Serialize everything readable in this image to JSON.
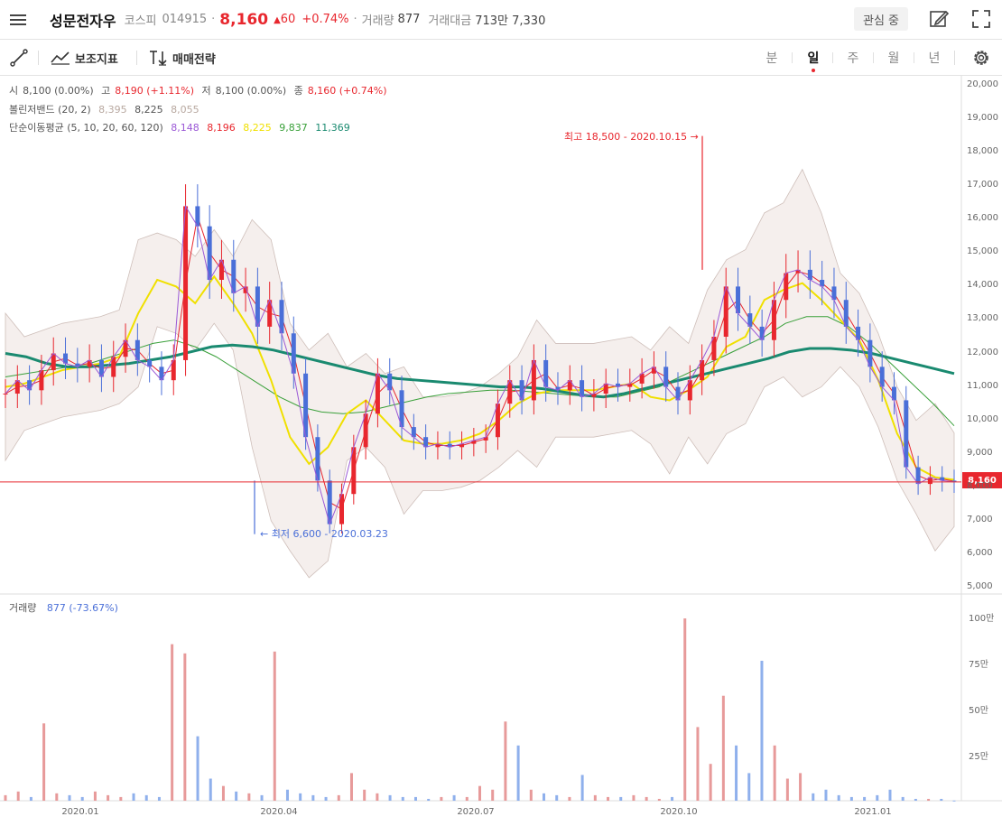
{
  "header": {
    "menu_icon": "hamburger-menu-icon",
    "stock_name": "성문전자우",
    "market": "코스피",
    "code": "014915",
    "price": "8,160",
    "change_arrow": "▲",
    "change": "60",
    "change_pct": "+0.74%",
    "volume_label": "거래량",
    "volume_value": "877",
    "trade_amount_label": "거래대금",
    "trade_amount_value": "713만 7,330",
    "favorite_label": "관심 중",
    "edit_icon": "edit-icon",
    "fullscreen_icon": "fullscreen-icon"
  },
  "toolbar": {
    "draw_icon": "line-draw-icon",
    "indicator_label": "보조지표",
    "strategy_label": "매매전략",
    "periods": [
      "분",
      "일",
      "주",
      "월",
      "년"
    ],
    "active_period": "일",
    "settings_icon": "gear-icon"
  },
  "legend": {
    "ohlc": [
      {
        "label": "시",
        "value": "8,100 (0.00%)",
        "color": "#555555"
      },
      {
        "label": "고",
        "value": "8,190 (+1.11%)",
        "color": "#e8272e"
      },
      {
        "label": "저",
        "value": "8,100 (0.00%)",
        "color": "#555555"
      },
      {
        "label": "종",
        "value": "8,160 (+0.74%)",
        "color": "#e8272e"
      }
    ],
    "bollinger_label": "볼린저밴드 (20, 2)",
    "bollinger_values": [
      {
        "value": "8,395",
        "color": "#b8a8a0"
      },
      {
        "value": "8,225",
        "color": "#555555"
      },
      {
        "value": "8,055",
        "color": "#b8a8a0"
      }
    ],
    "ma_label": "단순이동평균 (5, 10, 20, 60, 120)",
    "ma_values": [
      {
        "value": "8,148",
        "color": "#9b59d6"
      },
      {
        "value": "8,196",
        "color": "#e8272e"
      },
      {
        "value": "8,225",
        "color": "#f0e000"
      },
      {
        "value": "9,837",
        "color": "#3aa03a"
      },
      {
        "value": "11,369",
        "color": "#1a8a70"
      }
    ]
  },
  "annotations": {
    "high": "최고 18,500 - 2020.10.15 →",
    "low": "← 최저 6,600 - 2020.03.23"
  },
  "current_price_label": "8,160",
  "volume_legend": {
    "label": "거래량",
    "value": "877 (-73.67%)"
  },
  "colors": {
    "up": "#e8272e",
    "down": "#4a6fd8",
    "ma5": "#9b59d6",
    "ma10": "#e8272e",
    "ma20": "#f0e000",
    "ma60": "#3aa03a",
    "ma120": "#1a8a70"
  },
  "chart_data": {
    "type": "candlestick",
    "price_axis_ticks": [
      "20,000",
      "19,000",
      "18,000",
      "17,000",
      "16,000",
      "15,000",
      "14,000",
      "13,000",
      "12,000",
      "11,000",
      "10,000",
      "9,000",
      "8,000",
      "7,000",
      "6,000",
      "5,000"
    ],
    "ylim": [
      5000,
      20000
    ],
    "volume_axis_ticks": [
      "100만",
      "75만",
      "50만",
      "25만"
    ],
    "volume_ylim": [
      0,
      1000000
    ],
    "x_ticks": [
      "2020.01",
      "2020.04",
      "2020.07",
      "2020.10",
      "2021.01"
    ],
    "high": {
      "value": 18500,
      "date": "2020.10.15"
    },
    "low": {
      "value": 6600,
      "date": "2020.03.23"
    },
    "last_close": 8160,
    "closes": [
      10800,
      11200,
      10900,
      11500,
      12000,
      11700,
      11600,
      11800,
      11300,
      11900,
      12400,
      11800,
      11600,
      11200,
      11800,
      16400,
      15800,
      14200,
      14800,
      13800,
      14000,
      12800,
      13600,
      12600,
      11400,
      9500,
      8200,
      6900,
      7800,
      9200,
      10200,
      11400,
      10900,
      9800,
      9500,
      9200,
      9300,
      9200,
      9300,
      9400,
      9500,
      10500,
      11200,
      10600,
      11800,
      11000,
      10900,
      11200,
      10700,
      10800,
      11100,
      11000,
      11100,
      11400,
      11600,
      11000,
      10600,
      11200,
      11800,
      12500,
      14000,
      13200,
      12800,
      12400,
      13600,
      14400,
      14500,
      14200,
      14000,
      13600,
      12800,
      12400,
      11600,
      11000,
      10600,
      8600,
      8100,
      8300,
      8200,
      8160
    ],
    "ma120": [
      12000,
      11900,
      11700,
      11600,
      11600,
      11650,
      11700,
      11800,
      11900,
      12050,
      12200,
      12250,
      12200,
      12100,
      11950,
      11800,
      11650,
      11500,
      11350,
      11250,
      11200,
      11150,
      11100,
      11050,
      11000,
      11000,
      10950,
      10850,
      10750,
      10700,
      10800,
      10950,
      11100,
      11250,
      11400,
      11550,
      11700,
      11850,
      12050,
      12150,
      12150,
      12100,
      12000,
      11850,
      11700,
      11550,
      11400
    ],
    "ma60": [
      11300,
      11400,
      11500,
      11600,
      11700,
      11900,
      12100,
      12300,
      12400,
      12200,
      11900,
      11500,
      11100,
      10700,
      10400,
      10250,
      10200,
      10250,
      10400,
      10550,
      10700,
      10800,
      10850,
      10900,
      10900,
      10850,
      10800,
      10750,
      10700,
      10700,
      10850,
      11000,
      11300,
      11600,
      11900,
      12200,
      12500,
      12900,
      13100,
      13100,
      12800,
      12300,
      11700,
      11100,
      10500,
      9837
    ],
    "ma20": [
      11000,
      11100,
      11300,
      11500,
      11600,
      11700,
      11900,
      13200,
      14200,
      14000,
      13500,
      14300,
      13500,
      12600,
      11200,
      9500,
      8700,
      9200,
      10200,
      10600,
      10000,
      9400,
      9300,
      9300,
      9400,
      9600,
      10000,
      10500,
      10800,
      10900,
      10900,
      10900,
      11000,
      11100,
      10700,
      10600,
      10900,
      11300,
      12200,
      12500,
      13600,
      13900,
      14100,
      13600,
      13000,
      12400,
      11200,
      9600,
      8600,
      8300,
      8225
    ],
    "volumes_wan": [
      3,
      5,
      2,
      42,
      4,
      3,
      2,
      5,
      3,
      2,
      4,
      3,
      2,
      85,
      80,
      35,
      12,
      8,
      5,
      4,
      3,
      81,
      6,
      4,
      3,
      2,
      3,
      15,
      6,
      4,
      3,
      2,
      2,
      1,
      2,
      3,
      2,
      8,
      6,
      43,
      30,
      6,
      4,
      3,
      2,
      14,
      3,
      2,
      2,
      3,
      2,
      1,
      2,
      99,
      40,
      20,
      57,
      30,
      15,
      76,
      30,
      12,
      15,
      4,
      6,
      3,
      2,
      2,
      3,
      6,
      2,
      1,
      1,
      1,
      0.1
    ]
  }
}
